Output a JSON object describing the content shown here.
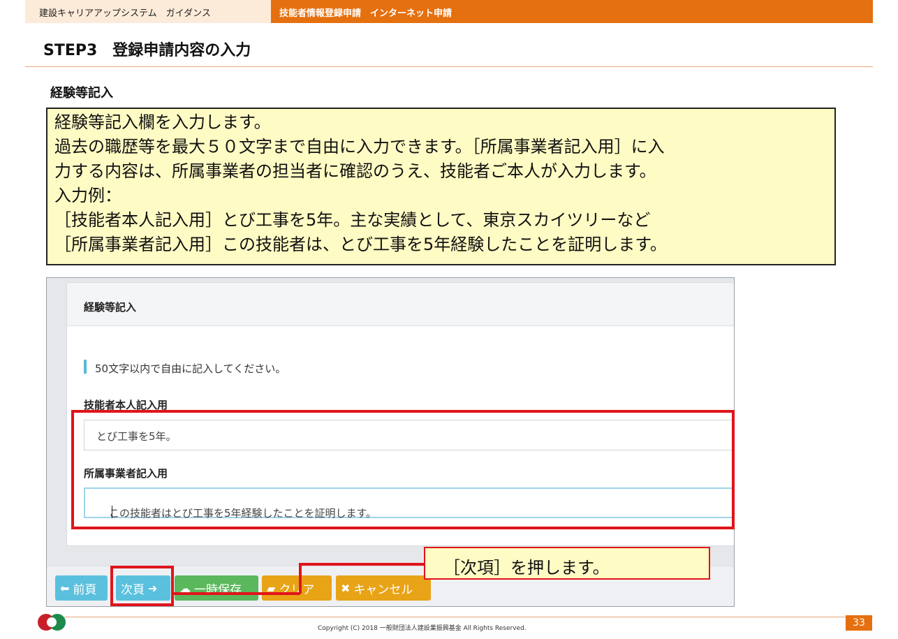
{
  "header": {
    "left_label": "建設キャリアアップシステム　ガイダンス",
    "right_label": "技能者情報登録申請　インターネット申請"
  },
  "step_title": "STEP3　登録申請内容の入力",
  "section_title": "経験等記入",
  "note": {
    "lines": [
      "経験等記入欄を入力します。",
      "過去の職歴等を最大５０文字まで自由に入力できます。［所属事業者記入用］に入",
      "力する内容は、所属事業者の担当者に確認のうえ、技能者ご本人が入力します。",
      "入力例：",
      "［技能者本人記入用］とび工事を5年。主な実績として、東京スカイツリーなど",
      "［所属事業者記入用］この技能者は、とび工事を5年経験したことを証明します。"
    ]
  },
  "form": {
    "card_title": "経験等記入",
    "info": "50文字以内で自由に記入してください。",
    "worker_label": "技能者本人記入用",
    "worker_value": "とび工事を5年。",
    "company_label": "所属事業者記入用",
    "company_value": "この技能者はとび工事を5年経験したことを証明します。"
  },
  "buttons": {
    "prev": "前頁",
    "next": "次頁",
    "save": "一時保存",
    "clear": "クリア",
    "cancel": "キャンセル"
  },
  "callout": "［次項］を押します。",
  "footer": {
    "copyright": "Copyright (C) 2018 一般財団法人建設業振興基金 All Rights Reserved.",
    "page_number": "33"
  },
  "colors": {
    "accent_orange": "#e5700f",
    "note_yellow": "#fffbc4",
    "callout_red": "#e0141b",
    "btn_blue": "#5bc0de",
    "btn_green": "#5cb85c",
    "btn_yellow": "#e8a317"
  },
  "icons": [
    "arrow-left-icon",
    "arrow-right-icon",
    "cloud-upload-icon",
    "eraser-icon",
    "times-icon"
  ]
}
